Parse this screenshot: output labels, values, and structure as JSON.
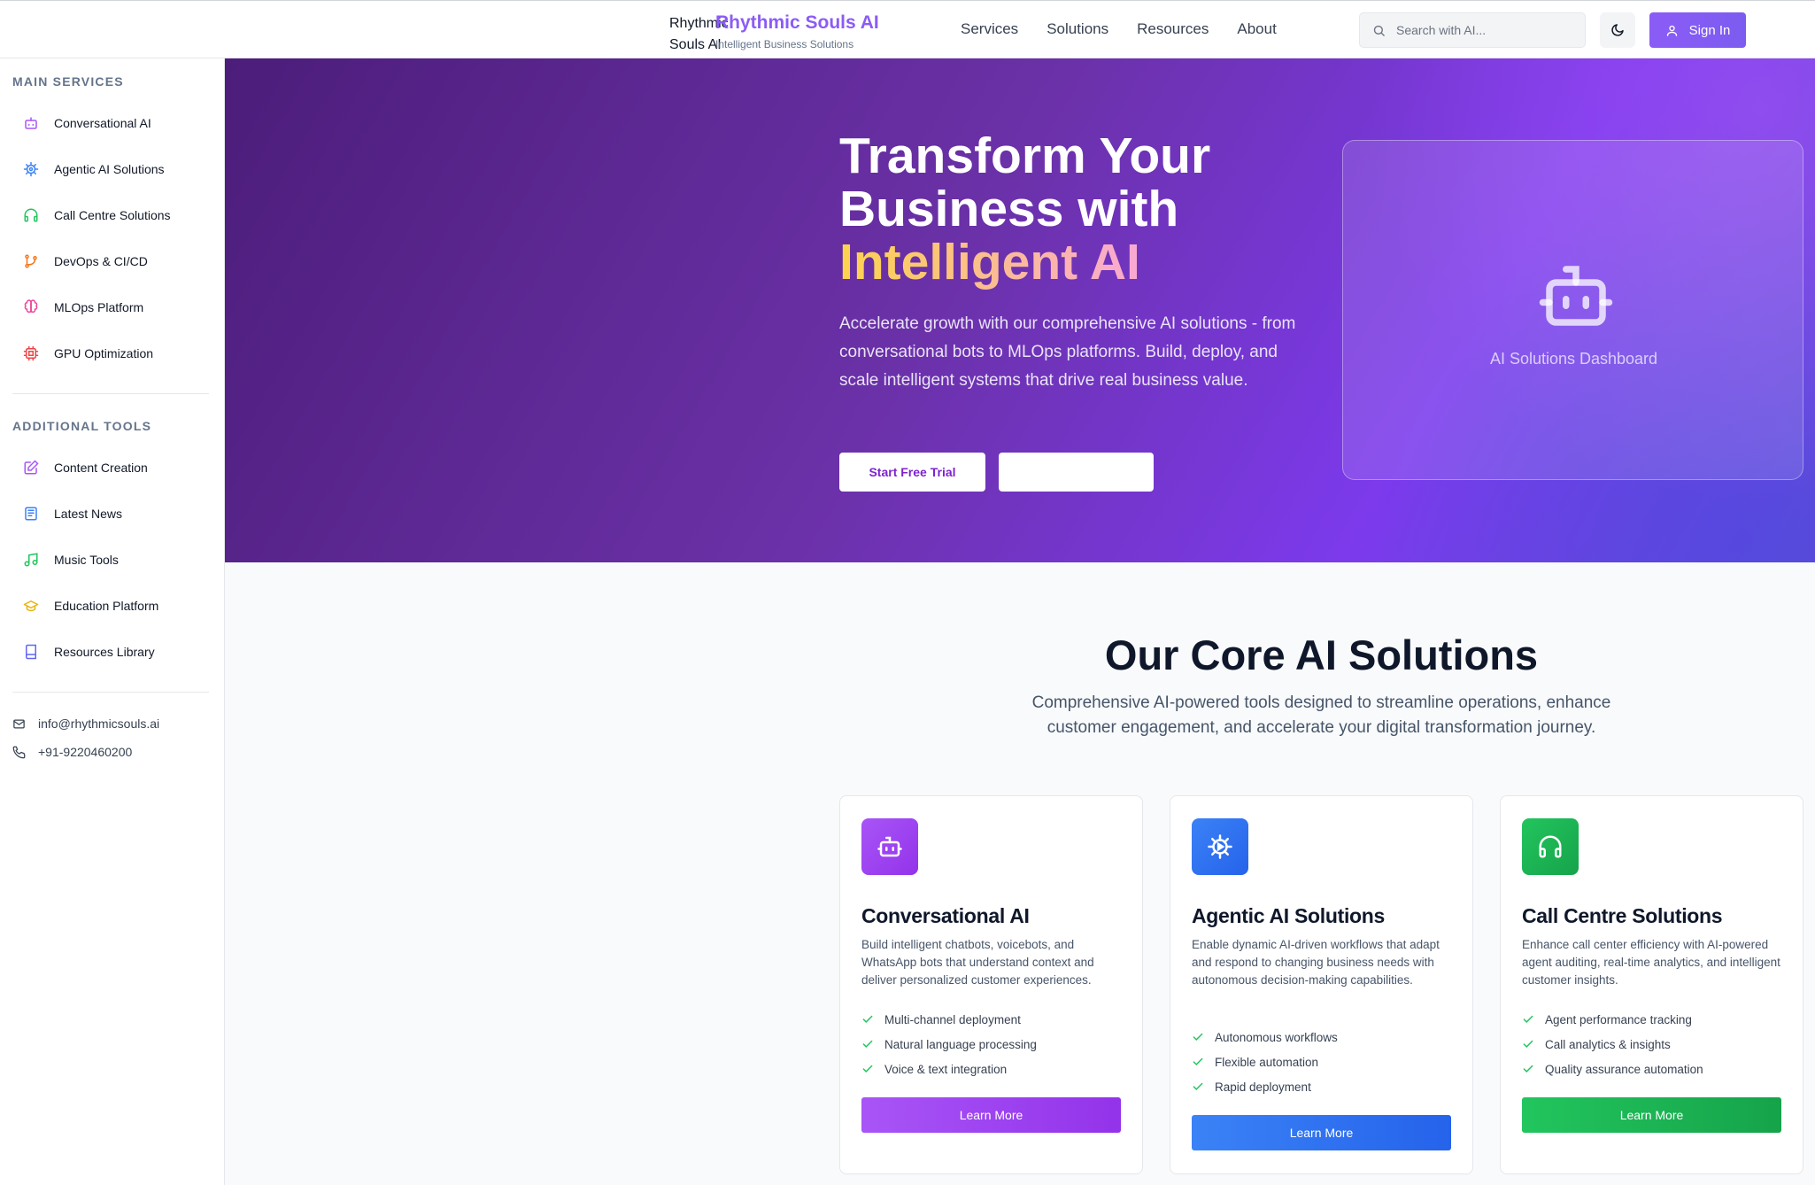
{
  "header": {
    "logo_alt": "Rhythmic Souls AI Logo",
    "brand_title": "Rhythmic Souls AI",
    "brand_subtitle": "Intelligent Business Solutions",
    "nav": [
      {
        "label": "Services"
      },
      {
        "label": "Solutions"
      },
      {
        "label": "Resources"
      },
      {
        "label": "About"
      }
    ],
    "search_placeholder": "Search with AI...",
    "theme_icon": "moon-icon",
    "signin_label": "Sign In"
  },
  "sidebar": {
    "main_heading": "MAIN SERVICES",
    "main_items": [
      {
        "label": "Conversational AI",
        "icon": "bot-icon",
        "color": "#a855f7"
      },
      {
        "label": "Agentic AI Solutions",
        "icon": "cog-icon",
        "color": "#3b82f6"
      },
      {
        "label": "Call Centre Solutions",
        "icon": "headphones-icon",
        "color": "#22c55e"
      },
      {
        "label": "DevOps & CI/CD",
        "icon": "git-branch-icon",
        "color": "#f97316"
      },
      {
        "label": "MLOps Platform",
        "icon": "brain-icon",
        "color": "#ec4899"
      },
      {
        "label": "GPU Optimization",
        "icon": "cpu-icon",
        "color": "#ef4444"
      }
    ],
    "tools_heading": "ADDITIONAL TOOLS",
    "tool_items": [
      {
        "label": "Content Creation",
        "icon": "edit-icon",
        "color": "#a855f7"
      },
      {
        "label": "Latest News",
        "icon": "newspaper-icon",
        "color": "#3b82f6"
      },
      {
        "label": "Music Tools",
        "icon": "music-icon",
        "color": "#22c55e"
      },
      {
        "label": "Education Platform",
        "icon": "graduation-cap-icon",
        "color": "#eab308"
      },
      {
        "label": "Resources Library",
        "icon": "book-icon",
        "color": "#6366f1"
      }
    ],
    "email": "info@rhythmicsouls.ai",
    "phone": "+91-9220460200"
  },
  "hero": {
    "title_line1": "Transform Your",
    "title_line2": "Business with",
    "title_accent": "Intelligent AI",
    "description": "Accelerate growth with our comprehensive AI solutions - from conversational bots to MLOps platforms. Build, deploy, and scale intelligent systems that drive real business value.",
    "primary_button": "Start Free Trial",
    "dashboard_label": "AI Solutions Dashboard"
  },
  "solutions": {
    "title": "Our Core AI Solutions",
    "description": "Comprehensive AI-powered tools designed to streamline operations, enhance customer engagement, and accelerate your digital transformation journey.",
    "cards": [
      {
        "title": "Conversational AI",
        "icon": "bot-icon",
        "color": "#a855f7",
        "description": "Build intelligent chatbots, voicebots, and WhatsApp bots that understand context and deliver personalized customer experiences.",
        "features": [
          "Multi-channel deployment",
          "Natural language processing",
          "Voice & text integration"
        ],
        "button": "Learn More"
      },
      {
        "title": "Agentic AI Solutions",
        "icon": "cog-icon",
        "color": "#3b82f6",
        "description": "Enable dynamic AI-driven workflows that adapt and respond to changing business needs with autonomous decision-making capabilities.",
        "features": [
          "Autonomous workflows",
          "Flexible automation",
          "Rapid deployment"
        ],
        "button": "Learn More"
      },
      {
        "title": "Call Centre Solutions",
        "icon": "headphones-icon",
        "color": "#22c55e",
        "description": "Enhance call center efficiency with AI-powered agent auditing, real-time analytics, and intelligent customer insights.",
        "features": [
          "Agent performance tracking",
          "Call analytics & insights",
          "Quality assurance automation"
        ],
        "button": "Learn More"
      }
    ]
  }
}
